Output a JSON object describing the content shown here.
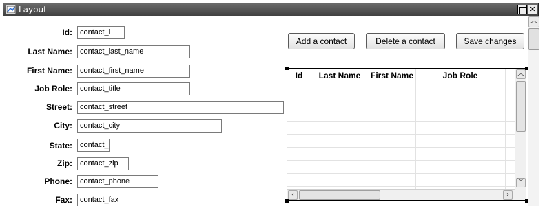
{
  "window": {
    "title": "Layout"
  },
  "form": {
    "id": {
      "label": "Id:",
      "value": "contact_i"
    },
    "last_name": {
      "label": "Last Name:",
      "value": "contact_last_name"
    },
    "first_name": {
      "label": "First Name:",
      "value": "contact_first_name"
    },
    "job_role": {
      "label": "Job Role:",
      "value": "contact_title"
    },
    "street": {
      "label": "Street:",
      "value": "contact_street"
    },
    "city": {
      "label": "City:",
      "value": "contact_city"
    },
    "state": {
      "label": "State:",
      "value": "contact_"
    },
    "zip": {
      "label": "Zip:",
      "value": "contact_zip"
    },
    "phone": {
      "label": "Phone:",
      "value": "contact_phone"
    },
    "fax": {
      "label": "Fax:",
      "value": "contact_fax"
    }
  },
  "toolbar": {
    "add_label": "Add a contact",
    "delete_label": "Delete a contact",
    "save_label": "Save changes"
  },
  "grid": {
    "columns": [
      "Id",
      "Last Name",
      "First Name",
      "Job Role"
    ],
    "rows": []
  },
  "icons": {
    "window": "window-icon",
    "maximize": "maximize-icon",
    "close": "close-icon"
  }
}
